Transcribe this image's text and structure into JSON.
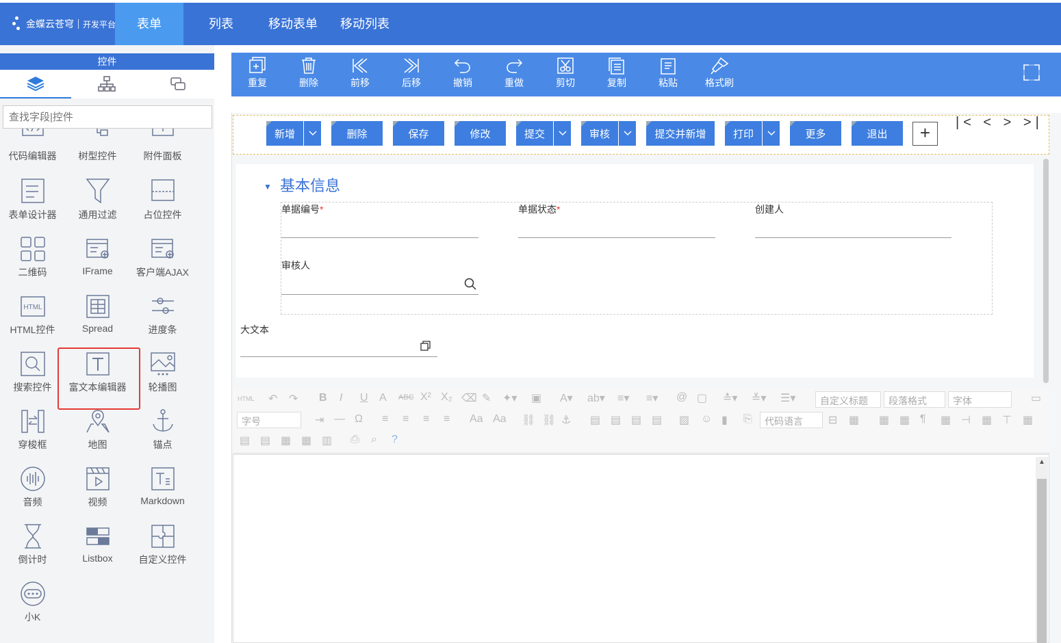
{
  "header": {
    "logo_text": "金蝶云苍穹",
    "logo_sub": "开发平台",
    "tabs": [
      {
        "label": "表单",
        "active": true
      },
      {
        "label": "列表",
        "active": false
      },
      {
        "label": "移动表单",
        "active": false
      },
      {
        "label": "移动列表",
        "active": false
      }
    ]
  },
  "sidebar": {
    "title": "控件",
    "tab_icons": [
      "layers-icon",
      "tree-icon",
      "copy-icon"
    ],
    "search_placeholder": "查找字段|控件",
    "controls": [
      {
        "label": "代码编辑器",
        "icon": "code-editor-icon"
      },
      {
        "label": "树型控件",
        "icon": "tree-control-icon"
      },
      {
        "label": "附件面板",
        "icon": "attachment-panel-icon"
      },
      {
        "label": "表单设计器",
        "icon": "form-designer-icon"
      },
      {
        "label": "通用过滤",
        "icon": "filter-icon"
      },
      {
        "label": "占位控件",
        "icon": "placeholder-icon"
      },
      {
        "label": "二维码",
        "icon": "qrcode-icon"
      },
      {
        "label": "IFrame",
        "icon": "iframe-icon"
      },
      {
        "label": "客户端AJAX",
        "icon": "ajax-icon"
      },
      {
        "label": "HTML控件",
        "icon": "html-icon"
      },
      {
        "label": "Spread",
        "icon": "spread-icon"
      },
      {
        "label": "进度条",
        "icon": "progress-icon"
      },
      {
        "label": "搜索控件",
        "icon": "search-control-icon"
      },
      {
        "label": "富文本编辑器",
        "icon": "rich-text-icon"
      },
      {
        "label": "轮播图",
        "icon": "carousel-icon"
      },
      {
        "label": "穿梭框",
        "icon": "transfer-icon"
      },
      {
        "label": "地图",
        "icon": "map-icon"
      },
      {
        "label": "锚点",
        "icon": "anchor-icon"
      },
      {
        "label": "音频",
        "icon": "audio-icon"
      },
      {
        "label": "视频",
        "icon": "video-icon"
      },
      {
        "label": "Markdown",
        "icon": "markdown-icon"
      },
      {
        "label": "倒计时",
        "icon": "hourglass-icon"
      },
      {
        "label": "Listbox",
        "icon": "listbox-icon"
      },
      {
        "label": "自定义控件",
        "icon": "puzzle-icon"
      },
      {
        "label": "小K",
        "icon": "chatbot-icon"
      }
    ]
  },
  "toolbar": {
    "items": [
      {
        "label": "重复",
        "icon": "duplicate-icon"
      },
      {
        "label": "删除",
        "icon": "trash-icon"
      },
      {
        "label": "前移",
        "icon": "move-forward-icon"
      },
      {
        "label": "后移",
        "icon": "move-back-icon"
      },
      {
        "label": "撤销",
        "icon": "undo-icon"
      },
      {
        "label": "重做",
        "icon": "redo-icon"
      },
      {
        "label": "剪切",
        "icon": "cut-icon"
      },
      {
        "label": "复制",
        "icon": "copy-icon"
      },
      {
        "label": "粘贴",
        "icon": "paste-icon"
      },
      {
        "label": "格式刷",
        "icon": "format-brush-icon"
      }
    ],
    "fullscreen_icon": "fullscreen-icon"
  },
  "form_buttons": [
    {
      "label": "新增",
      "dropdown": true
    },
    {
      "label": "删除",
      "dropdown": false
    },
    {
      "label": "保存",
      "dropdown": false
    },
    {
      "label": "修改",
      "dropdown": false
    },
    {
      "label": "提交",
      "dropdown": true
    },
    {
      "label": "审核",
      "dropdown": true
    },
    {
      "label": "提交并新增",
      "dropdown": false
    },
    {
      "label": "打印",
      "dropdown": true
    },
    {
      "label": "更多",
      "dropdown": false
    },
    {
      "label": "退出",
      "dropdown": false
    }
  ],
  "add_button": "+",
  "pager": "|< < > >|",
  "form": {
    "section_title": "基本信息",
    "fields": [
      {
        "label": "单据编号",
        "required": true
      },
      {
        "label": "单据状态",
        "required": true
      },
      {
        "label": "创建人",
        "required": false
      },
      {
        "label": "审核人",
        "required": false
      }
    ],
    "bigtext_label": "大文本",
    "required_mark": "*"
  },
  "editor": {
    "html_label": "HTML",
    "custom_title": "自定义标题",
    "paragraph_format": "段落格式",
    "font": "字体",
    "font_size": "字号",
    "code_language": "代码语言"
  }
}
